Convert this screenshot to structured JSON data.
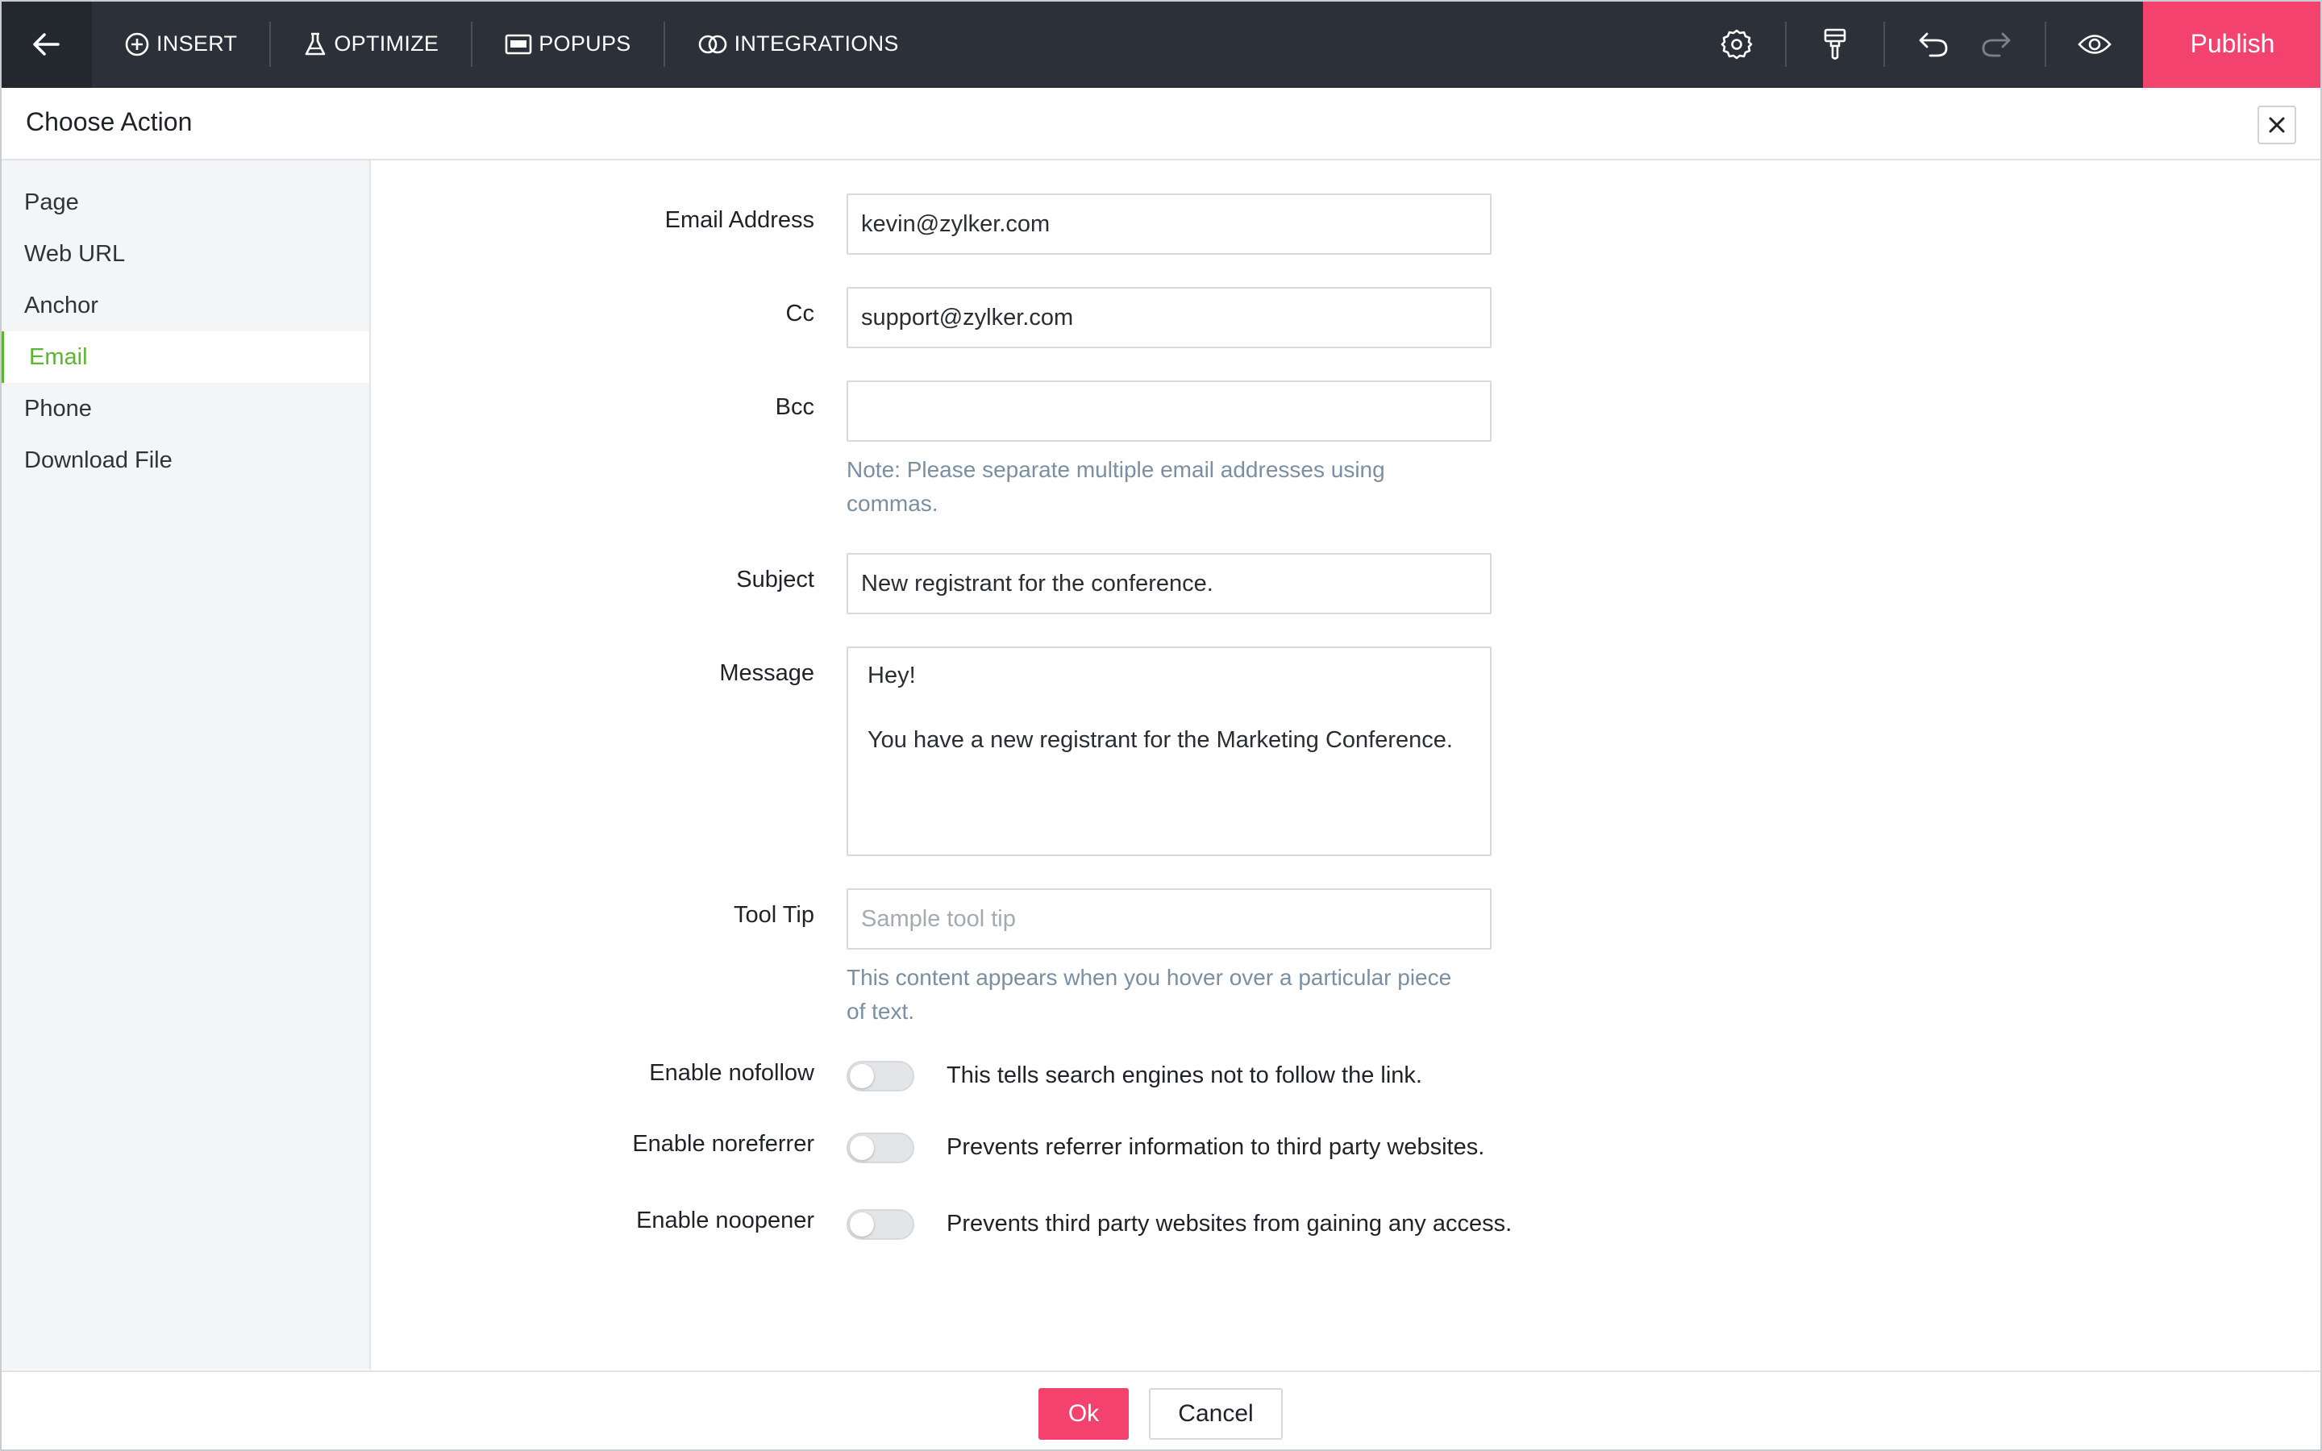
{
  "toolbar": {
    "nav": [
      {
        "label": "INSERT",
        "icon": "plus-circle-icon"
      },
      {
        "label": "OPTIMIZE",
        "icon": "flask-icon"
      },
      {
        "label": "POPUPS",
        "icon": "popup-icon"
      },
      {
        "label": "INTEGRATIONS",
        "icon": "integrations-icon"
      }
    ],
    "tools": [
      "gear-icon",
      "paint-brush-icon",
      "undo-icon",
      "redo-icon",
      "eye-icon"
    ],
    "publish_label": "Publish"
  },
  "dialog": {
    "title": "Choose Action"
  },
  "sidebar": {
    "items": [
      {
        "label": "Page"
      },
      {
        "label": "Web URL"
      },
      {
        "label": "Anchor"
      },
      {
        "label": "Email"
      },
      {
        "label": "Phone"
      },
      {
        "label": "Download File"
      }
    ],
    "active": "Email"
  },
  "form": {
    "email_label": "Email Address",
    "email_value": "kevin@zylker.com",
    "cc_label": "Cc",
    "cc_value": "support@zylker.com",
    "bcc_label": "Bcc",
    "bcc_value": "",
    "bcc_note": "Note: Please separate multiple email addresses using commas.",
    "subject_label": "Subject",
    "subject_value": "New registrant for the conference.",
    "message_label": "Message",
    "message_value": "Hey!\n\nYou have a new registrant for the Marketing Conference.",
    "tooltip_label": "Tool Tip",
    "tooltip_placeholder": "Sample tool tip",
    "tooltip_note": "This content appears when you hover over a particular piece of text.",
    "nofollow_label": "Enable nofollow",
    "nofollow_desc": "This tells search engines not to follow the link.",
    "noreferrer_label": "Enable noreferrer",
    "noreferrer_desc": "Prevents referrer information to third party websites.",
    "noopener_label": "Enable noopener",
    "noopener_desc": "Prevents third party websites from gaining any access."
  },
  "footer": {
    "ok_label": "Ok",
    "cancel_label": "Cancel"
  },
  "colors": {
    "toolbar": "#2c3139",
    "accent": "#f4426e",
    "active_green": "#5cb531",
    "hint": "#7a8fa3"
  }
}
